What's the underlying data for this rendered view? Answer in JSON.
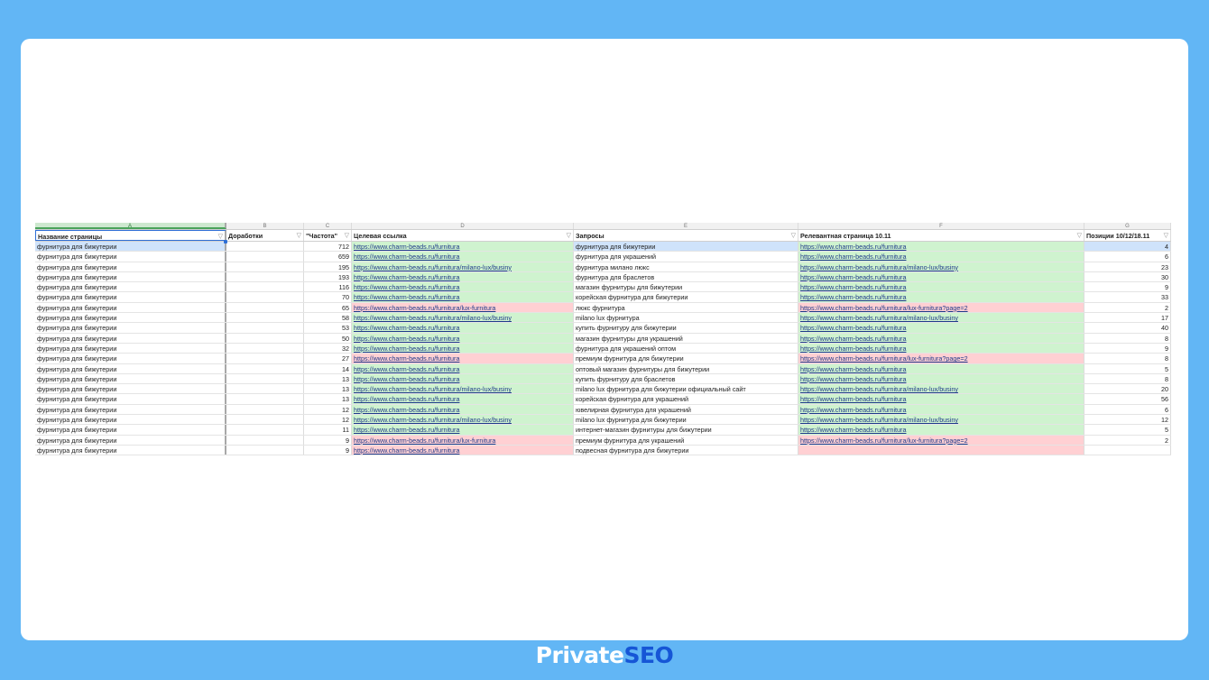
{
  "columns": [
    "A",
    "B",
    "C",
    "D",
    "E",
    "F",
    "G"
  ],
  "headers": {
    "a": "Название страницы",
    "b": "Доработки",
    "c": "\"Частота\"",
    "d": "Целевая ссылка",
    "e": "Запросы",
    "f": "Релевантная страница 10.11",
    "g": "Позиции 10/12/18.11"
  },
  "filter_icon": "▽",
  "rows": [
    {
      "name": "фурнитура для бижутерии",
      "freq": "712",
      "target": "https://www.charm-beads.ru/furnitura",
      "query": "фурнитура для бижутерии",
      "relevant": "https://www.charm-beads.ru/furnitura",
      "pos": "4",
      "tc": "g",
      "qc": "b",
      "rc": "g"
    },
    {
      "name": "фурнитура для бижутерии",
      "freq": "659",
      "target": "https://www.charm-beads.ru/furnitura",
      "query": "фурнитура для украшений",
      "relevant": "https://www.charm-beads.ru/furnitura",
      "pos": "6",
      "tc": "g",
      "qc": "",
      "rc": "g"
    },
    {
      "name": "фурнитура для бижутерии",
      "freq": "195",
      "target": "https://www.charm-beads.ru/furnitura/milano-lux/businy",
      "query": "фурнитура милано люкс",
      "relevant": "https://www.charm-beads.ru/furnitura/milano-lux/businy",
      "pos": "23",
      "tc": "g",
      "qc": "",
      "rc": "g"
    },
    {
      "name": "фурнитура для бижутерии",
      "freq": "193",
      "target": "https://www.charm-beads.ru/furnitura",
      "query": "фурнитура для браслетов",
      "relevant": "https://www.charm-beads.ru/furnitura",
      "pos": "30",
      "tc": "g",
      "qc": "",
      "rc": "g"
    },
    {
      "name": "фурнитура для бижутерии",
      "freq": "116",
      "target": "https://www.charm-beads.ru/furnitura",
      "query": "магазин фурнитуры для бижутерии",
      "relevant": "https://www.charm-beads.ru/furnitura",
      "pos": "9",
      "tc": "g",
      "qc": "",
      "rc": "g"
    },
    {
      "name": "фурнитура для бижутерии",
      "freq": "70",
      "target": "https://www.charm-beads.ru/furnitura",
      "query": "корейская фурнитура для бижутерии",
      "relevant": "https://www.charm-beads.ru/furnitura",
      "pos": "33",
      "tc": "g",
      "qc": "",
      "rc": "g"
    },
    {
      "name": "фурнитура для бижутерии",
      "freq": "65",
      "target": "https://www.charm-beads.ru/furnitura/lux-furnitura",
      "query": "люкс фурнитура",
      "relevant": "https://www.charm-beads.ru/furnitura/lux-furnitura?page=2",
      "pos": "2",
      "tc": "r",
      "qc": "",
      "rc": "r"
    },
    {
      "name": "фурнитура для бижутерии",
      "freq": "58",
      "target": "https://www.charm-beads.ru/furnitura/milano-lux/businy",
      "query": "milano lux фурнитура",
      "relevant": "https://www.charm-beads.ru/furnitura/milano-lux/businy",
      "pos": "17",
      "tc": "g",
      "qc": "",
      "rc": "g"
    },
    {
      "name": "фурнитура для бижутерии",
      "freq": "53",
      "target": "https://www.charm-beads.ru/furnitura",
      "query": "купить фурнитуру для бижутерии",
      "relevant": "https://www.charm-beads.ru/furnitura",
      "pos": "40",
      "tc": "g",
      "qc": "",
      "rc": "g"
    },
    {
      "name": "фурнитура для бижутерии",
      "freq": "50",
      "target": "https://www.charm-beads.ru/furnitura",
      "query": "магазин фурнитуры для украшений",
      "relevant": "https://www.charm-beads.ru/furnitura",
      "pos": "8",
      "tc": "g",
      "qc": "",
      "rc": "g"
    },
    {
      "name": "фурнитура для бижутерии",
      "freq": "32",
      "target": "https://www.charm-beads.ru/furnitura",
      "query": "фурнитура для украшений оптом",
      "relevant": "https://www.charm-beads.ru/furnitura",
      "pos": "9",
      "tc": "g",
      "qc": "",
      "rc": "g"
    },
    {
      "name": "фурнитура для бижутерии",
      "freq": "27",
      "target": "https://www.charm-beads.ru/furnitura",
      "query": "премиум фурнитура для бижутерии",
      "relevant": "https://www.charm-beads.ru/furnitura/lux-furnitura?page=2",
      "pos": "8",
      "tc": "r",
      "qc": "",
      "rc": "r"
    },
    {
      "name": "фурнитура для бижутерии",
      "freq": "14",
      "target": "https://www.charm-beads.ru/furnitura",
      "query": "оптовый магазин фурнитуры для бижутерии",
      "relevant": "https://www.charm-beads.ru/furnitura",
      "pos": "5",
      "tc": "g",
      "qc": "",
      "rc": "g"
    },
    {
      "name": "фурнитура для бижутерии",
      "freq": "13",
      "target": "https://www.charm-beads.ru/furnitura",
      "query": "купить фурнитуру для браслетов",
      "relevant": "https://www.charm-beads.ru/furnitura",
      "pos": "8",
      "tc": "g",
      "qc": "",
      "rc": "g"
    },
    {
      "name": "фурнитура для бижутерии",
      "freq": "13",
      "target": "https://www.charm-beads.ru/furnitura/milano-lux/businy",
      "query": "milano lux фурнитура для бижутерии официальный сайт",
      "relevant": "https://www.charm-beads.ru/furnitura/milano-lux/businy",
      "pos": "20",
      "tc": "g",
      "qc": "",
      "rc": "g"
    },
    {
      "name": "фурнитура для бижутерии",
      "freq": "13",
      "target": "https://www.charm-beads.ru/furnitura",
      "query": "корейская фурнитура для украшений",
      "relevant": "https://www.charm-beads.ru/furnitura",
      "pos": "56",
      "tc": "g",
      "qc": "",
      "rc": "g"
    },
    {
      "name": "фурнитура для бижутерии",
      "freq": "12",
      "target": "https://www.charm-beads.ru/furnitura",
      "query": "ювелирная фурнитура для украшений",
      "relevant": "https://www.charm-beads.ru/furnitura",
      "pos": "6",
      "tc": "g",
      "qc": "",
      "rc": "g"
    },
    {
      "name": "фурнитура для бижутерии",
      "freq": "12",
      "target": "https://www.charm-beads.ru/furnitura/milano-lux/businy",
      "query": "milano lux фурнитура для бижутерии",
      "relevant": "https://www.charm-beads.ru/furnitura/milano-lux/businy",
      "pos": "12",
      "tc": "g",
      "qc": "",
      "rc": "g"
    },
    {
      "name": "фурнитура для бижутерии",
      "freq": "11",
      "target": "https://www.charm-beads.ru/furnitura",
      "query": "интернет-магазин фурнитуры для бижутерии",
      "relevant": "https://www.charm-beads.ru/furnitura",
      "pos": "5",
      "tc": "g",
      "qc": "",
      "rc": "g"
    },
    {
      "name": "фурнитура для бижутерии",
      "freq": "9",
      "target": "https://www.charm-beads.ru/furnitura/lux-furnitura",
      "query": "премиум фурнитура для украшений",
      "relevant": "https://www.charm-beads.ru/furnitura/lux-furnitura?page=2",
      "pos": "2",
      "tc": "r",
      "qc": "",
      "rc": "r"
    },
    {
      "name": "фурнитура для бижутерии",
      "freq": "9",
      "target": "https://www.charm-beads.ru/furnitura",
      "query": "подвесная фурнитура для бижутерии",
      "relevant": "",
      "pos": "",
      "tc": "r",
      "qc": "",
      "rc": "r"
    }
  ],
  "footer": {
    "brand_part1": "Private",
    "brand_part2": "SEO"
  }
}
